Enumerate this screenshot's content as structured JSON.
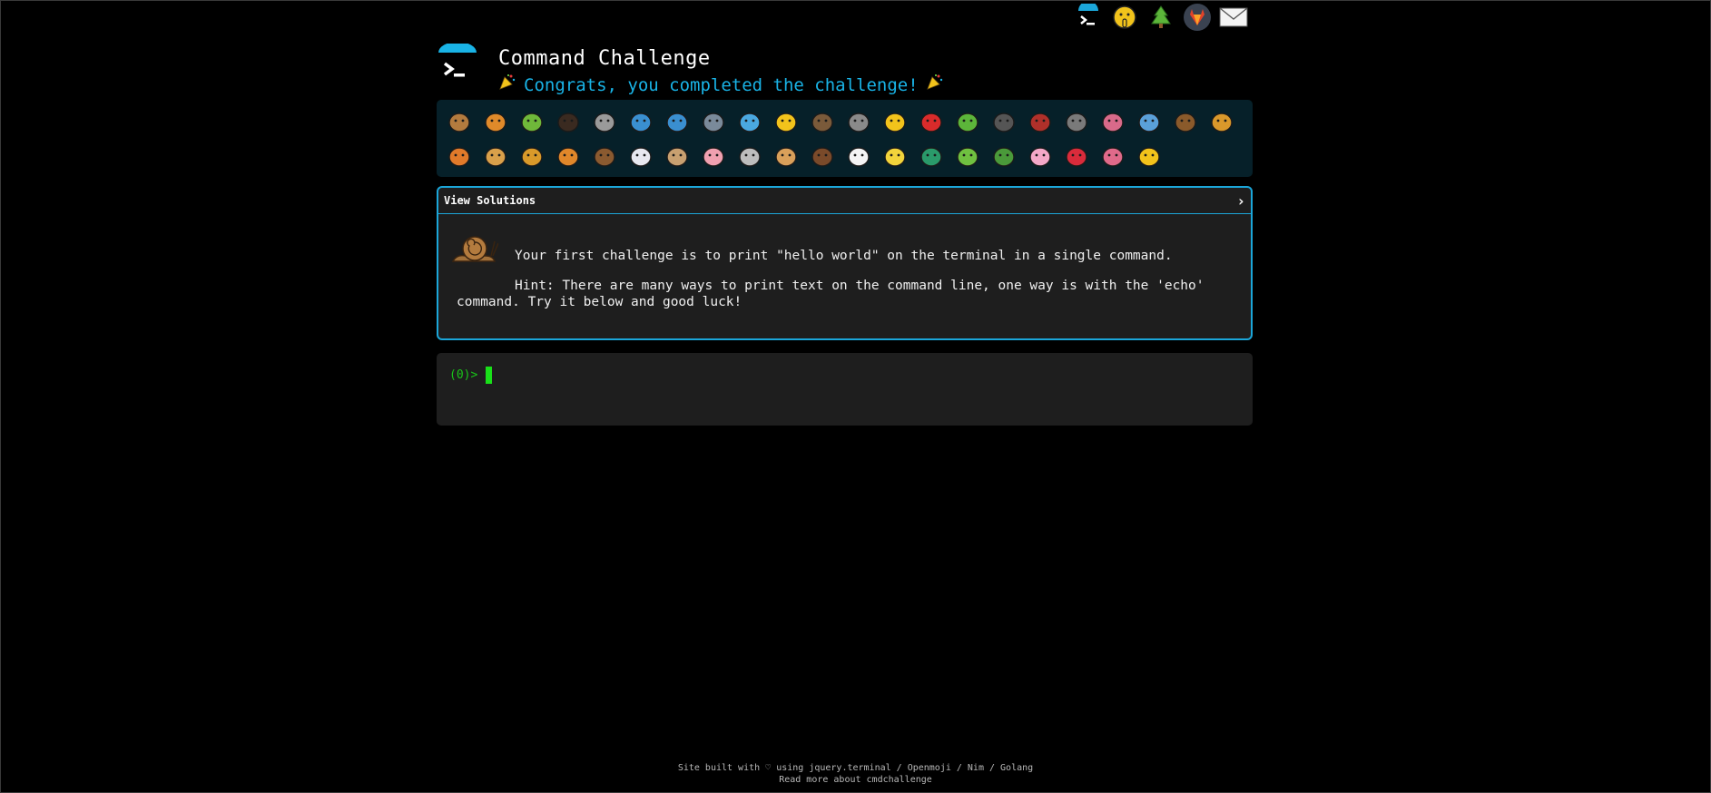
{
  "header": {
    "title": "Command Challenge",
    "subtitle": "Congrats, you completed the challenge!"
  },
  "top_icons": [
    {
      "name": "cmdchallenge-logo-icon"
    },
    {
      "name": "shushing-face-icon"
    },
    {
      "name": "tree-icon"
    },
    {
      "name": "gitlab-icon"
    },
    {
      "name": "mail-icon"
    }
  ],
  "emoji_rows": [
    [
      "snail",
      "butterfly",
      "caterpillar",
      "ant",
      "spider-web",
      "whale",
      "dolphin",
      "shark",
      "fish",
      "tropical-fish",
      "sloth",
      "wolf",
      "bee",
      "ladybug",
      "leaf",
      "mosquito",
      "scorpion",
      "fly",
      "worm",
      "microbe",
      "monkey",
      "dog"
    ],
    [
      "fox",
      "cat",
      "lion",
      "tiger",
      "horse",
      "unicorn",
      "cow",
      "pig",
      "mouse",
      "hamster",
      "bear",
      "panda",
      "hatching-chick",
      "peacock",
      "frog",
      "dragon",
      "cherry-blossom",
      "rose",
      "hibiscus",
      "sunflower"
    ]
  ],
  "panel": {
    "toggle_label": "View Solutions",
    "challenge": "Your first challenge is to print \"hello world\" on the terminal in a single command.",
    "hint": "Hint: There are many ways to print text on the command line, one way is with the 'echo' command. Try it below and good luck!"
  },
  "terminal": {
    "prompt_open": "(",
    "prompt_num": "0",
    "prompt_close": ")>"
  },
  "footer": {
    "line1": "Site built with ♡ using jquery.terminal / Openmoji / Nim / Golang",
    "line2": "Read more about cmdchallenge"
  }
}
